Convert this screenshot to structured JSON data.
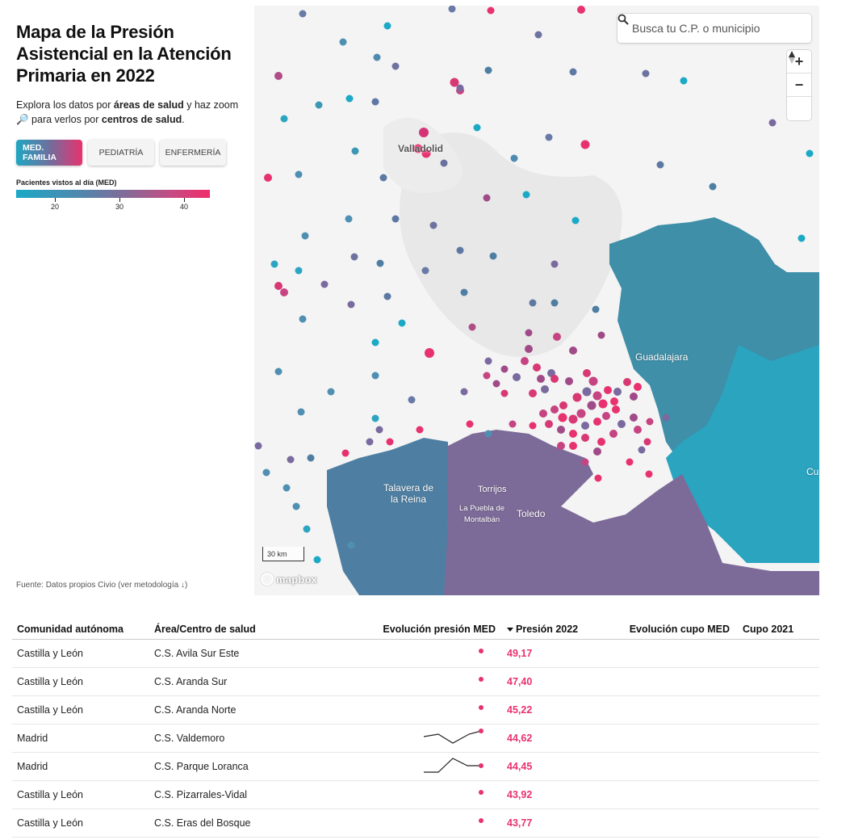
{
  "panel": {
    "title": "Mapa de la Presión Asistencial en la Atención Primaria en 2022",
    "intro_prefix": "Explora los datos por ",
    "intro_bold1": "áreas de salud",
    "intro_mid": " y haz zoom 🔎 para verlos por ",
    "intro_bold2": "centros de salud",
    "intro_end": ".",
    "buttons": [
      {
        "label": "MED. FAMILIA",
        "active": true
      },
      {
        "label": "PEDIATRÍA",
        "active": false
      },
      {
        "label": "ENFERMERÍA",
        "active": false
      }
    ],
    "legend_title": "Pacientes vistos al día (MED)",
    "legend_ticks": [
      "20",
      "30",
      "40"
    ]
  },
  "source": "Fuente: Datos propios Civio (ver metodología ↓)",
  "map": {
    "search_placeholder": "Busca tu C.P. o municipio",
    "zoom_in": "+",
    "zoom_out": "−",
    "compass": "↑",
    "scale_label": "30 km",
    "attribution": "mapbox",
    "places": {
      "valladolid": "Valladolid",
      "guadalajara": "Guadalajara",
      "talavera": "Talavera de la Reina",
      "torrijos": "Torrijos",
      "puebla": "La Puebla de Montalbán",
      "toledo": "Toledo",
      "cuenca": "Cu"
    },
    "colors": {
      "teal": "#1ba9c6",
      "blue": "#4a86ab",
      "purple": "#7c6a98",
      "pink": "#e8326f"
    }
  },
  "table": {
    "headers": {
      "region": "Comunidad autónoma",
      "center": "Área/Centro de salud",
      "evolution": "Evolución presión MED",
      "pressure": "Presión 2022",
      "quota_evolution": "Evolución cupo MED",
      "quota": "Cupo 2021"
    },
    "rows": [
      {
        "region": "Castilla y León",
        "center": "C.S. Avila Sur Este",
        "pressure": "49,17"
      },
      {
        "region": "Castilla y León",
        "center": "C.S. Aranda Sur",
        "pressure": "47,40"
      },
      {
        "region": "Castilla y León",
        "center": "C.S. Aranda Norte",
        "pressure": "45,22"
      },
      {
        "region": "Madrid",
        "center": "C.S. Valdemoro",
        "pressure": "44,62"
      },
      {
        "region": "Madrid",
        "center": "C.S. Parque Loranca",
        "pressure": "44,45"
      },
      {
        "region": "Castilla y León",
        "center": "C.S. Pizarrales-Vidal",
        "pressure": "43,92"
      },
      {
        "region": "Castilla y León",
        "center": "C.S. Eras del Bosque",
        "pressure": "43,77"
      }
    ]
  }
}
